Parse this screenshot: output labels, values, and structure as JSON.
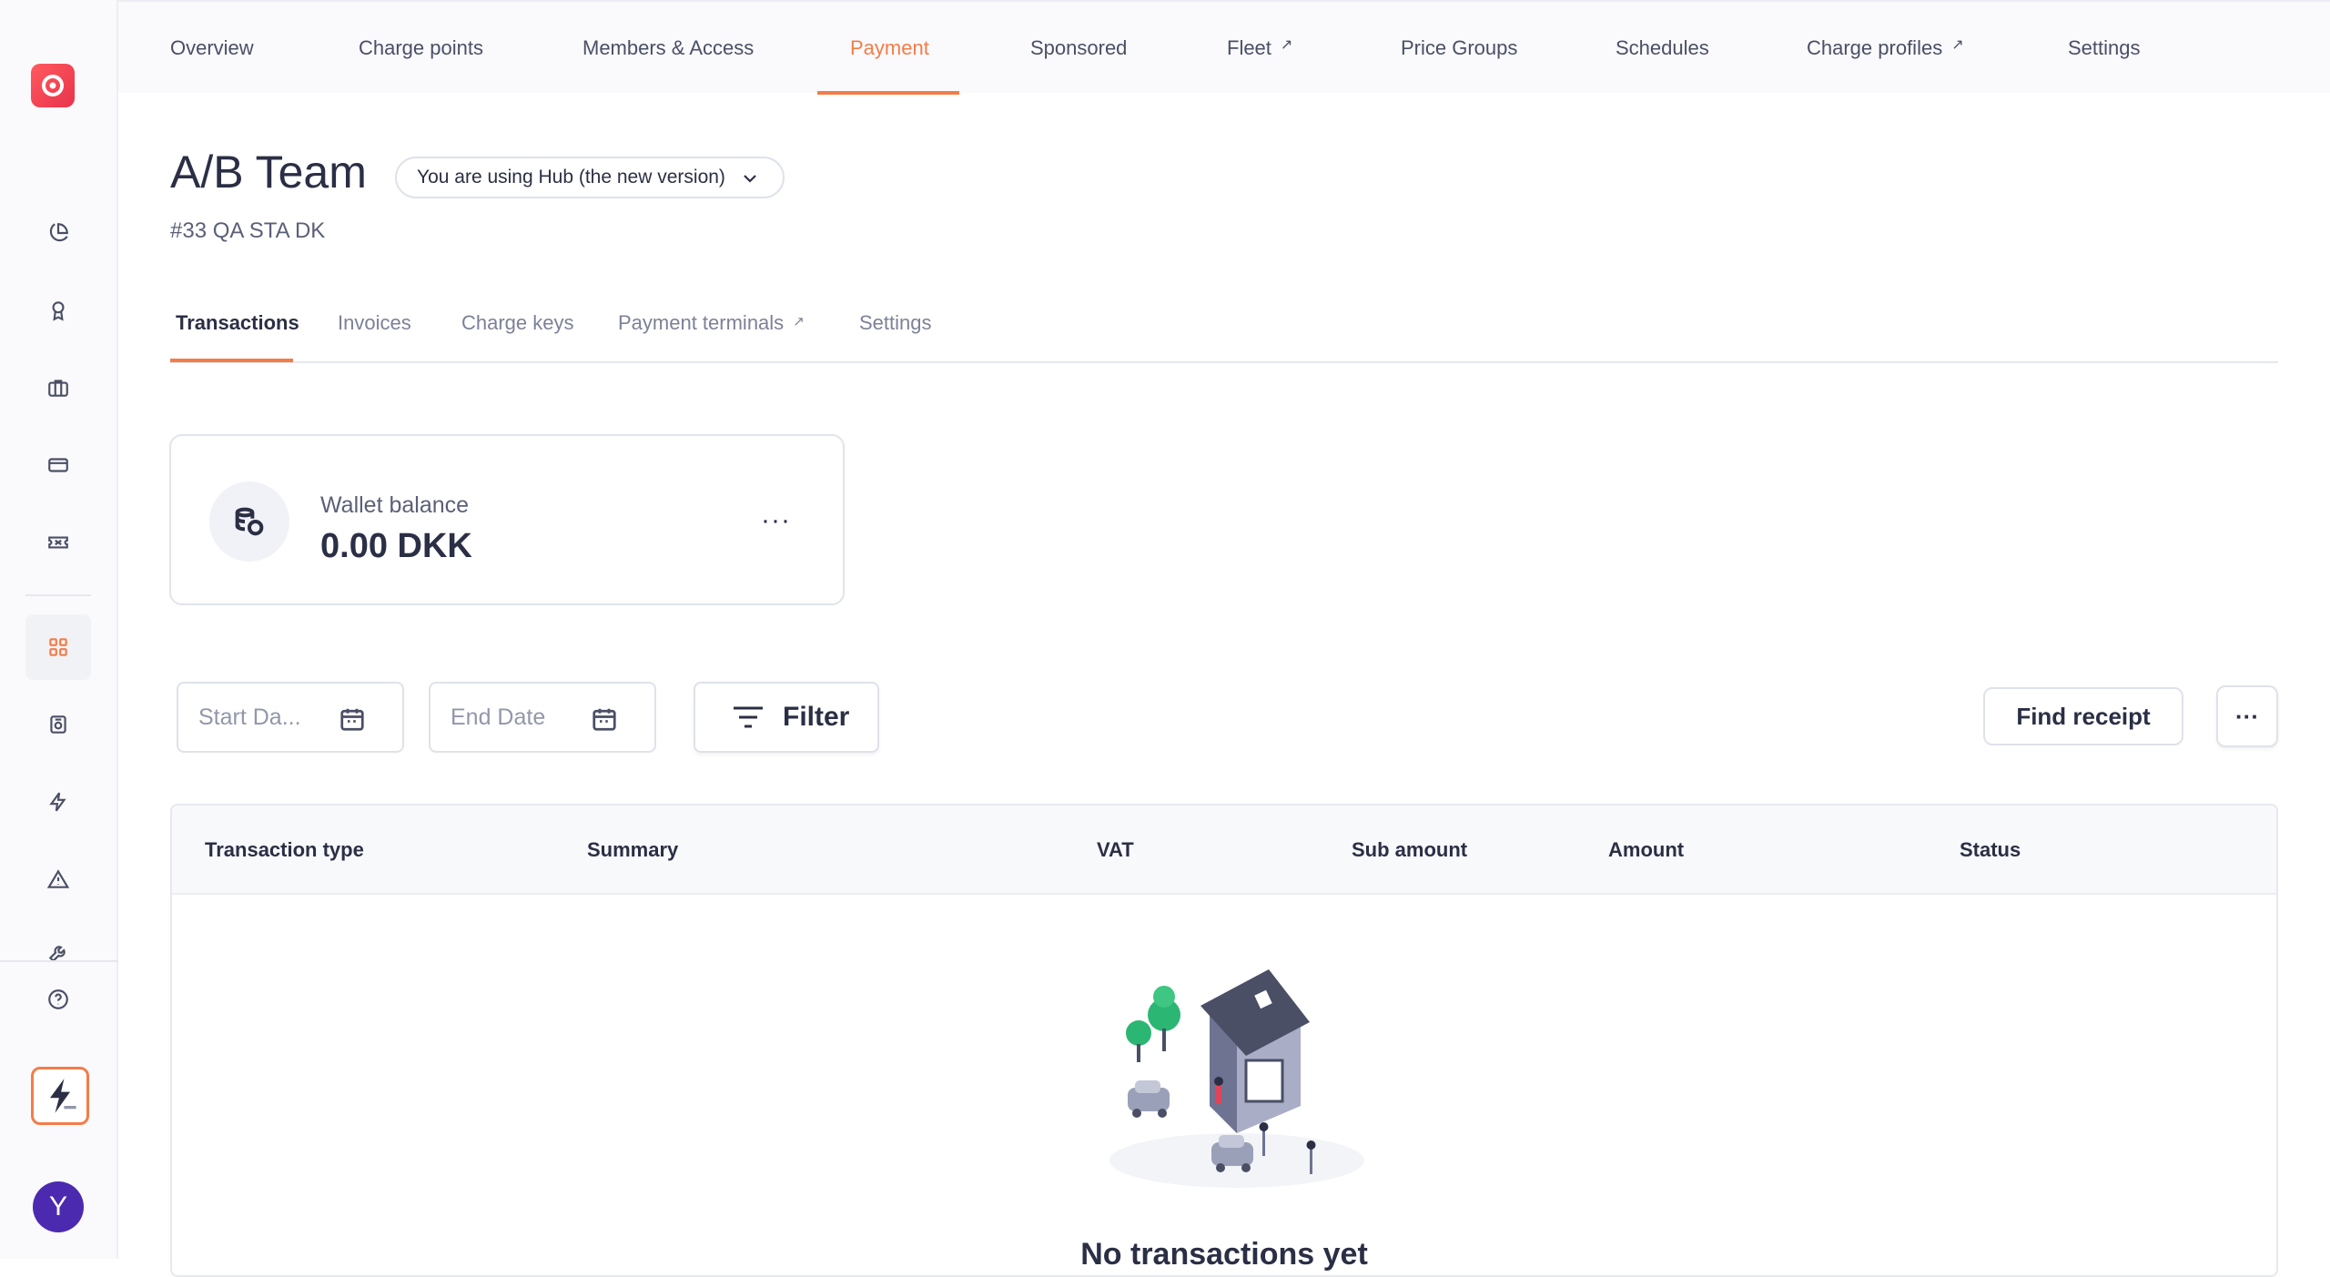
{
  "app": {
    "accent": "#f47c48",
    "avatar_initial": "Y"
  },
  "sidebar": {
    "items": [
      {
        "icon": "pie-chart-icon"
      },
      {
        "icon": "award-icon"
      },
      {
        "icon": "briefcase-icon"
      },
      {
        "icon": "credit-card-icon"
      },
      {
        "icon": "ticket-icon"
      },
      {
        "icon": "grid-icon",
        "active": true
      },
      {
        "icon": "charger-icon"
      },
      {
        "icon": "bolt-icon"
      },
      {
        "icon": "alert-icon"
      },
      {
        "icon": "wrench-icon"
      },
      {
        "icon": "help-icon"
      }
    ]
  },
  "topnav": {
    "items": [
      {
        "label": "Overview"
      },
      {
        "label": "Charge points"
      },
      {
        "label": "Members & Access"
      },
      {
        "label": "Payment",
        "active": true
      },
      {
        "label": "Sponsored"
      },
      {
        "label": "Fleet",
        "external": true
      },
      {
        "label": "Price Groups"
      },
      {
        "label": "Schedules"
      },
      {
        "label": "Charge profiles",
        "external": true
      },
      {
        "label": "Settings"
      }
    ]
  },
  "header": {
    "title": "A/B Team",
    "version_label": "You are using Hub (the new version)",
    "subtitle": "#33 QA STA DK"
  },
  "subtabs": {
    "items": [
      {
        "label": "Transactions",
        "active": true
      },
      {
        "label": "Invoices"
      },
      {
        "label": "Charge keys"
      },
      {
        "label": "Payment terminals",
        "external": true
      },
      {
        "label": "Settings"
      }
    ]
  },
  "wallet": {
    "label": "Wallet balance",
    "value": "0.00 DKK",
    "more": "···"
  },
  "filters": {
    "start_placeholder": "Start Da...",
    "end_placeholder": "End Date",
    "filter_label": "Filter",
    "find_receipt_label": "Find receipt",
    "more_label": "···"
  },
  "table": {
    "columns": [
      "Transaction type",
      "Summary",
      "VAT",
      "Sub amount",
      "Amount",
      "Status"
    ],
    "empty_text": "No transactions yet"
  }
}
